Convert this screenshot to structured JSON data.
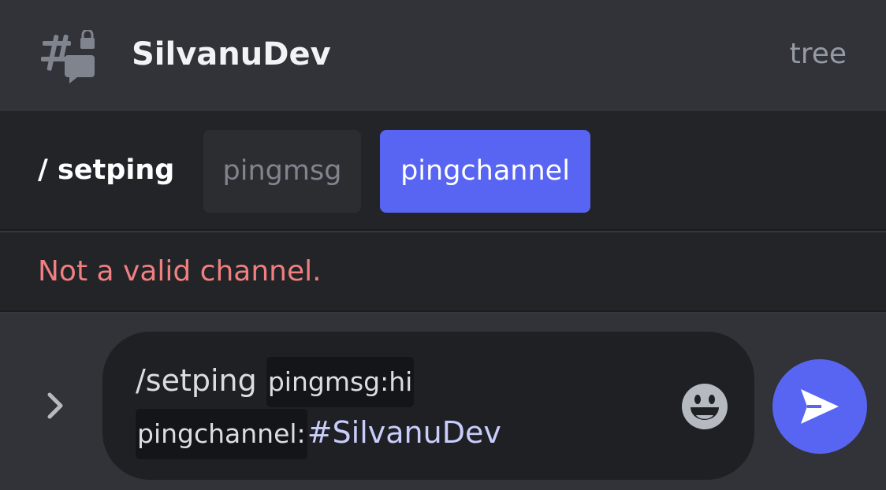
{
  "header": {
    "channel_icon": "private-thread-icon",
    "channel_name": "SilvanuDev",
    "right_text": "tree"
  },
  "command_bar": {
    "command": "/ setping",
    "options": [
      {
        "label": "pingmsg",
        "active": false
      },
      {
        "label": "pingchannel",
        "active": true
      }
    ]
  },
  "error": {
    "message": "Not a valid channel."
  },
  "composer": {
    "expand_icon": "chevron-right-icon",
    "command_text": "/setping ",
    "option1_label": "pingmsg:hi",
    "option2_label": "pingchannel:",
    "option2_value": "#SilvanuDev",
    "emoji_icon": "emoji-smile-icon",
    "send_icon": "send-icon"
  },
  "colors": {
    "accent": "#5865f2",
    "error": "#f07f80",
    "header_bg": "#313338",
    "panel_bg": "#232428"
  }
}
